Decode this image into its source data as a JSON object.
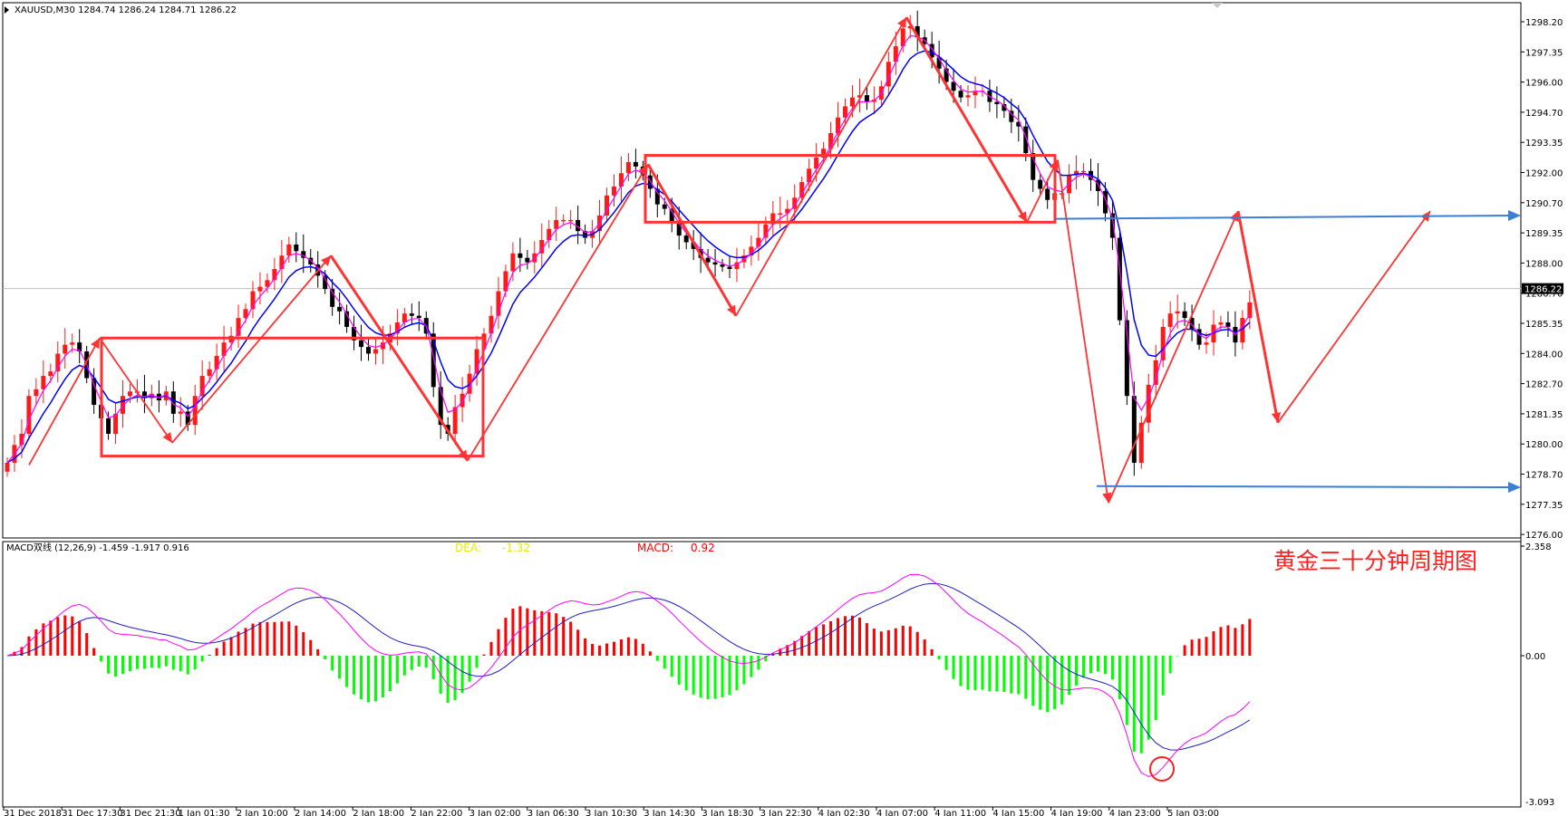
{
  "header": {
    "symbol_line": "XAUUSD,M30  1284.74 1286.24 1284.71 1286.22"
  },
  "macd_panel": {
    "label": "MACD双线 (12,26,9) -1.459 -1.917 0.916",
    "dea_label": "DEA:",
    "dea_value": "-1.32",
    "macd_label": "MACD:",
    "macd_value": "0.92",
    "caption": "黄金三十分钟周期图",
    "axis_top": "2.358",
    "axis_zero": "0.00",
    "axis_bottom": "-3.093"
  },
  "price_axis": {
    "labels": [
      "1298.20",
      "1297.35",
      "1296.00",
      "1294.70",
      "1293.35",
      "1292.00",
      "1290.70",
      "1289.35",
      "1288.00",
      "1286.70",
      "1285.35",
      "1284.00",
      "1282.70",
      "1281.35",
      "1280.00",
      "1278.70",
      "1277.35",
      "1276.00"
    ],
    "current_price": "1286.22"
  },
  "time_axis": {
    "labels": [
      "31 Dec 2018",
      "31 Dec 17:30",
      "31 Dec 21:30",
      "1 Jan 01:30",
      "2 Jan 10:00",
      "2 Jan 14:00",
      "2 Jan 18:00",
      "2 Jan 22:00",
      "3 Jan 02:00",
      "3 Jan 06:30",
      "3 Jan 10:30",
      "3 Jan 14:30",
      "3 Jan 18:30",
      "3 Jan 22:30",
      "4 Jan 02:30",
      "4 Jan 07:00",
      "4 Jan 11:00",
      "4 Jan 15:00",
      "4 Jan 19:00",
      "4 Jan 23:00",
      "5 Jan 03:00"
    ]
  },
  "colors": {
    "bull": "#ff1a1a",
    "bear": "#000000",
    "ma_fast": "#ff00ff",
    "ma_slow": "#0000ff",
    "macd_pos": "#ff0000",
    "macd_neg": "#00ff00",
    "annotation": "#ff3333",
    "levels": "#3a7fd5",
    "dea_text": "#e8e800",
    "macd_text": "#ff0000"
  },
  "chart_data": {
    "type": "candlestick",
    "symbol": "XAUUSD",
    "timeframe": "M30",
    "ylim": [
      1275.7,
      1298.9
    ],
    "closes": [
      1278.4,
      1279.2,
      1279.7,
      1281.4,
      1281.7,
      1282.3,
      1282.5,
      1283.3,
      1283.7,
      1283.8,
      1283.4,
      1282.2,
      1281.0,
      1280.4,
      1279.7,
      1280.6,
      1281.4,
      1281.6,
      1281.6,
      1281.3,
      1281.5,
      1281.2,
      1281.6,
      1280.6,
      1280.7,
      1280.1,
      1281.4,
      1282.3,
      1282.6,
      1283.2,
      1283.8,
      1284.1,
      1284.9,
      1285.3,
      1286.1,
      1286.3,
      1286.6,
      1287.1,
      1287.7,
      1288.2,
      1287.9,
      1287.6,
      1287.3,
      1286.8,
      1286.2,
      1285.4,
      1285.2,
      1284.5,
      1283.9,
      1283.6,
      1283.3,
      1283.5,
      1283.8,
      1284.2,
      1284.7,
      1285.1,
      1285.0,
      1284.9,
      1284.2,
      1281.8,
      1280.1,
      1279.7,
      1280.9,
      1281.5,
      1282.4,
      1283.5,
      1284.2,
      1285.0,
      1286.1,
      1287.0,
      1287.8,
      1287.6,
      1287.4,
      1287.8,
      1288.4,
      1288.9,
      1289.3,
      1289.3,
      1289.3,
      1288.8,
      1288.5,
      1288.8,
      1289.5,
      1290.4,
      1290.8,
      1291.4,
      1291.9,
      1291.7,
      1291.3,
      1290.7,
      1290.0,
      1289.8,
      1289.2,
      1288.6,
      1288.3,
      1288.0,
      1287.6,
      1287.4,
      1287.3,
      1287.2,
      1287.1,
      1287.4,
      1287.7,
      1288.1,
      1288.5,
      1289.1,
      1289.6,
      1289.6,
      1289.8,
      1290.3,
      1291.0,
      1291.6,
      1292.1,
      1292.5,
      1293.2,
      1293.9,
      1294.4,
      1294.8,
      1294.9,
      1294.6,
      1294.7,
      1295.3,
      1296.4,
      1297.1,
      1297.9,
      1298.0,
      1297.5,
      1297.2,
      1296.6,
      1296.1,
      1295.5,
      1295.1,
      1294.8,
      1294.9,
      1295.1,
      1295.1,
      1294.6,
      1294.5,
      1294.2,
      1293.7,
      1293.5,
      1292.3,
      1291.1,
      1290.7,
      1290.2,
      1290.5,
      1290.5,
      1291.3,
      1291.5,
      1291.5,
      1291.1,
      1290.6,
      1289.6,
      1288.5,
      1284.8,
      1281.4,
      1278.4,
      1280.2,
      1281.9,
      1283.0,
      1284.5,
      1285.1,
      1285.2,
      1284.9,
      1284.4,
      1283.7,
      1283.8,
      1284.6,
      1284.7,
      1284.5,
      1283.8,
      1284.9,
      1285.6
    ],
    "candle_count": 169,
    "ma_fast": {
      "name": "",
      "color": "#ff00ff"
    },
    "ma_slow": {
      "name": "",
      "color": "#0000ff"
    },
    "current_price": 1286.22,
    "support_line": 1277.35,
    "resistance_line": 1289.35,
    "macd": {
      "params": "12,26,9",
      "values_line": [
        -1.459,
        -1.917,
        0.916
      ],
      "dea": -1.32,
      "macd": 0.92,
      "ylim": [
        -3.093,
        2.358
      ]
    }
  }
}
